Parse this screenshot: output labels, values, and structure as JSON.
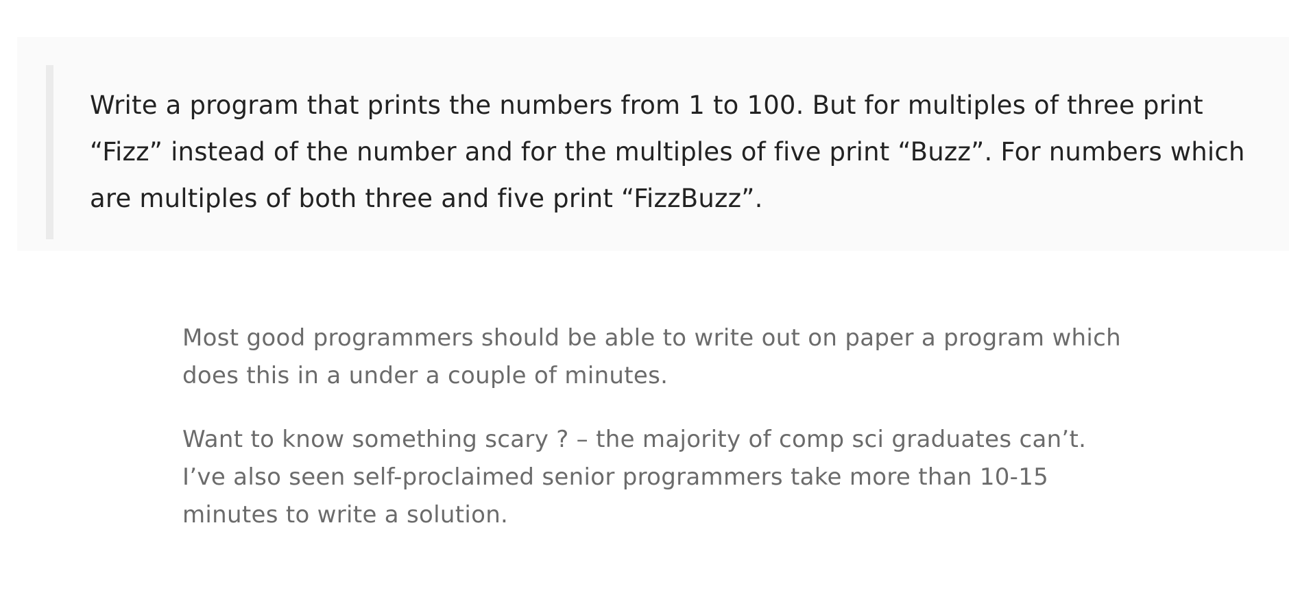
{
  "blockquote": {
    "text": "Write a program that prints the numbers from 1 to 100. But for multiples of three print “Fizz” instead of the number and for the multiples of five print “Buzz”. For numbers which are multiples of both three and five print “FizzBuzz”."
  },
  "paragraphs": [
    {
      "text": "Most good programmers should be able to write out on paper a program which does this in a under a couple of minutes."
    },
    {
      "text": "Want to know something scary ? – the majority of comp sci graduates can’t. I’ve also seen self-proclaimed senior programmers take more than 10-15 minutes to write a solution."
    }
  ]
}
